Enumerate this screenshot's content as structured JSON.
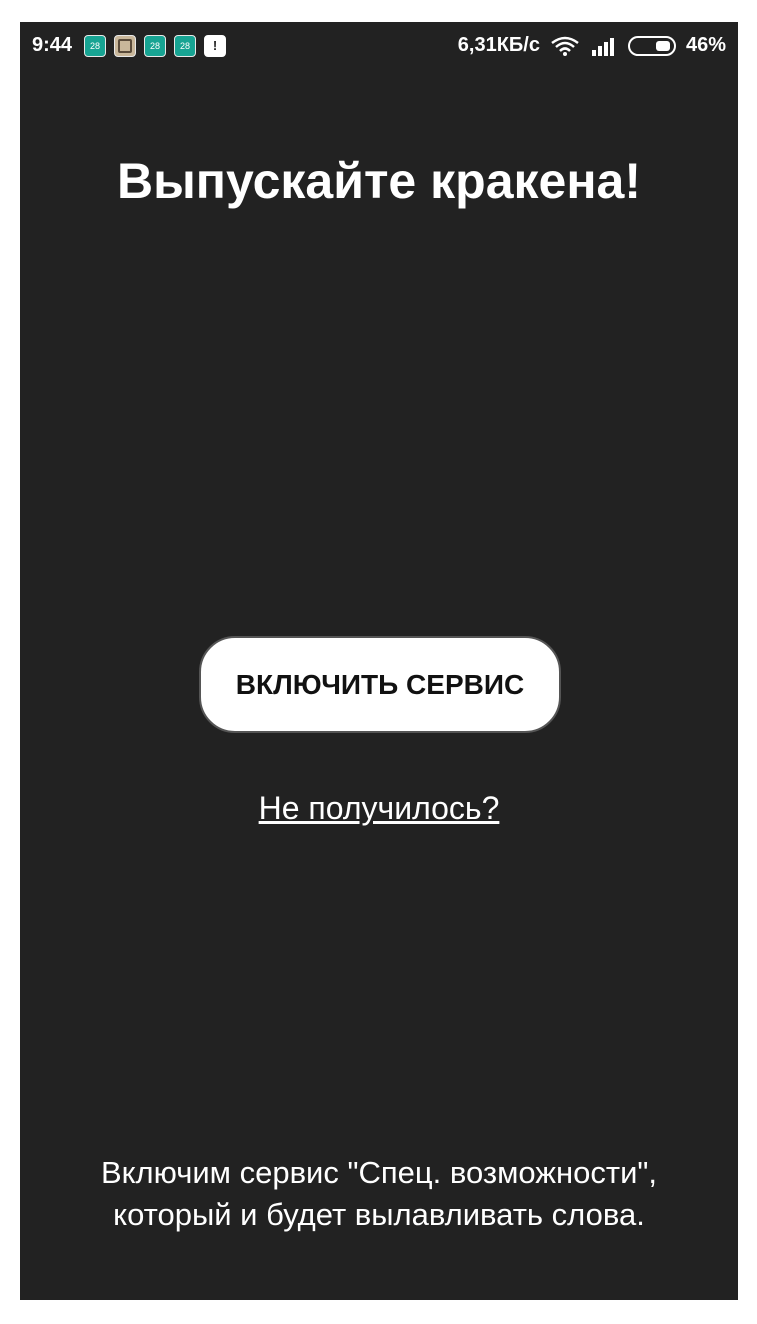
{
  "status_bar": {
    "time": "9:44",
    "notifications": [
      "28",
      "photo-icon",
      "28",
      "28",
      "app-icon"
    ],
    "notif_text": "28",
    "network_speed": "6,31КБ/с",
    "battery": "46%",
    "icons": [
      "wifi-icon",
      "signal-icon",
      "battery-icon"
    ]
  },
  "main": {
    "title": "Выпускайте кракена!",
    "enable_button": "ВКЛЮЧИТЬ СЕРВИС",
    "help_link": "Не получилось?",
    "footer_line1": "Включим сервис \"Спец. возможности\",",
    "footer_line2": "который и будет вылавливать слова."
  },
  "colors": {
    "background": "#222222",
    "button_bg": "#ffffff",
    "text": "#ffffff",
    "notif_accent": "#17a493"
  }
}
